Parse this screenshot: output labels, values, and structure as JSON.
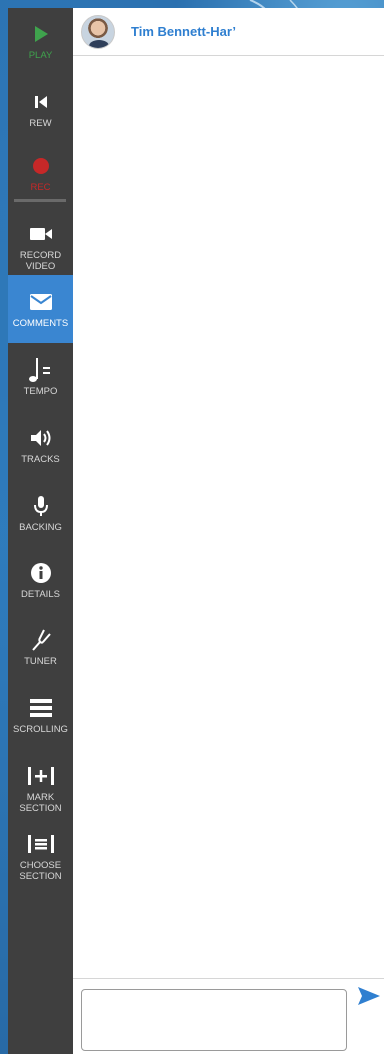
{
  "header": {
    "user_name": "Tim Bennett-Har’"
  },
  "sidebar": {
    "items": [
      {
        "label": "PLAY",
        "icon": "play-icon",
        "color": "#3fa34d"
      },
      {
        "label": "REW",
        "icon": "rewind-icon",
        "color": "#d8d8d8"
      },
      {
        "label": "REC",
        "icon": "record-icon",
        "color": "#c62828"
      },
      {
        "label": "RECORD VIDEO",
        "icon": "video-camera-icon",
        "color": "#d8d8d8"
      },
      {
        "label": "COMMENTS",
        "icon": "envelope-icon",
        "color": "#ffffff",
        "active": true
      },
      {
        "label": "TEMPO",
        "icon": "tempo-note-icon",
        "color": "#d8d8d8"
      },
      {
        "label": "TRACKS",
        "icon": "speaker-icon",
        "color": "#d8d8d8"
      },
      {
        "label": "BACKING",
        "icon": "microphone-icon",
        "color": "#d8d8d8"
      },
      {
        "label": "DETAILS",
        "icon": "info-icon",
        "color": "#d8d8d8"
      },
      {
        "label": "TUNER",
        "icon": "tuning-fork-icon",
        "color": "#d8d8d8"
      },
      {
        "label": "SCROLLING",
        "icon": "scrolling-icon",
        "color": "#d8d8d8"
      },
      {
        "label": "MARK SECTION",
        "icon": "mark-section-icon",
        "color": "#d8d8d8"
      },
      {
        "label": "CHOOSE SECTION",
        "icon": "choose-section-icon",
        "color": "#d8d8d8"
      }
    ]
  },
  "comments": {
    "input_value": "",
    "send_icon": "send-icon"
  },
  "colors": {
    "accent": "#3a86d1",
    "sidebar_bg": "#3f3f3f",
    "name_color": "#2f7fd0"
  }
}
